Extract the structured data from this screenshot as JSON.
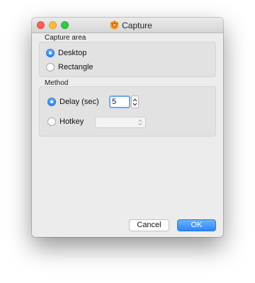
{
  "window": {
    "title": "Capture",
    "app_icon": "capture-app-icon"
  },
  "capture_area": {
    "label": "Capture area",
    "selected": "Desktop",
    "options": [
      "Desktop",
      "Rectangle"
    ]
  },
  "method": {
    "label": "Method",
    "selected": "Delay (sec)",
    "delay_label": "Delay (sec)",
    "delay_value": "5",
    "hotkey_label": "Hotkey",
    "hotkey_value": ""
  },
  "buttons": {
    "cancel": "Cancel",
    "ok": "OK"
  },
  "colors": {
    "accent": "#2a82f7",
    "window_bg": "#ececec",
    "panel_bg": "#e2e2e2"
  }
}
